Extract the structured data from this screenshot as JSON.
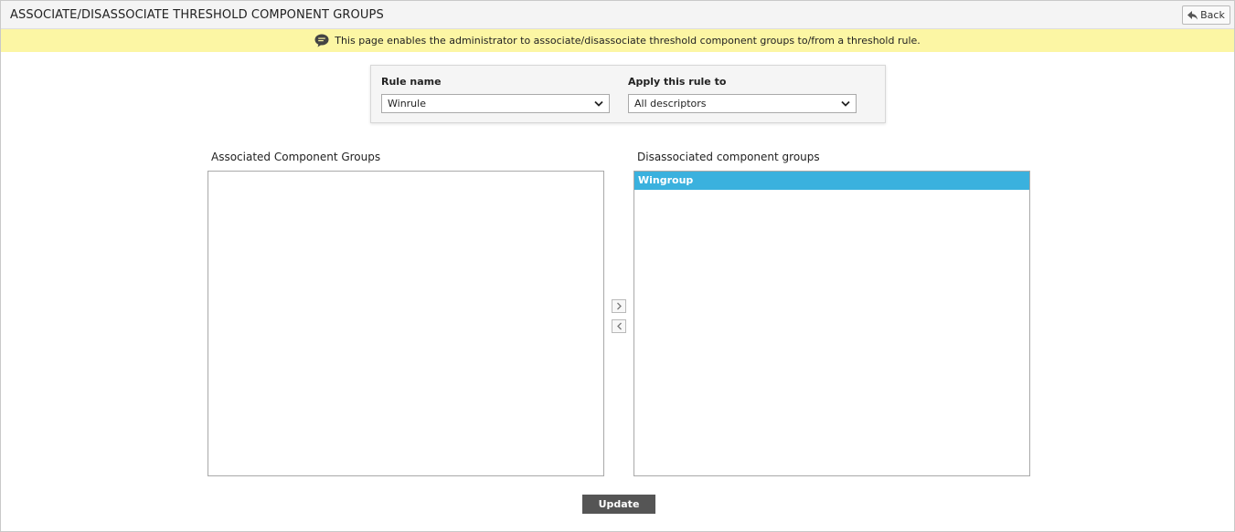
{
  "header": {
    "title": "ASSOCIATE/DISASSOCIATE THRESHOLD COMPONENT GROUPS",
    "back_label": "Back"
  },
  "info_bar": {
    "icon": "speech-bubble-icon",
    "text": "This page enables the administrator to associate/disassociate threshold component groups to/from a threshold rule."
  },
  "rule_form": {
    "rule_name_label": "Rule name",
    "rule_name_value": "Winrule",
    "apply_label": "Apply this rule to",
    "apply_value": "All descriptors"
  },
  "associated": {
    "title": "Associated Component Groups",
    "items": []
  },
  "disassociated": {
    "title": "Disassociated component groups",
    "items": [
      {
        "label": "Wingroup",
        "selected": true
      }
    ]
  },
  "actions": {
    "update_label": "Update"
  },
  "colors": {
    "info_bar_bg": "#fcf6a4",
    "selected_item_bg": "#3ab1de",
    "update_button_bg": "#555555"
  }
}
